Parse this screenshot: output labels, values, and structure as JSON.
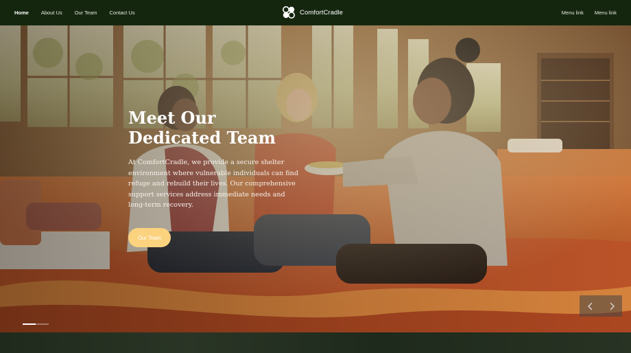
{
  "nav": {
    "left_links": [
      {
        "label": "Home",
        "active": true
      },
      {
        "label": "About Us",
        "active": false
      },
      {
        "label": "Our Team",
        "active": false
      },
      {
        "label": "Contact Us",
        "active": false
      }
    ],
    "brand": "ComfortCradle",
    "right_links": [
      "Menu link",
      "Menu link"
    ]
  },
  "hero": {
    "title": "Meet Our Dedicated Team",
    "text": "At ComfortCradle, we provide a secure shelter environment where vulnerable individuals can find refuge and rebuild their lives. Our comprehensive support services address immediate needs and long-term recovery.",
    "button_label": "Our Team"
  },
  "carousel": {
    "prev_icon": "chevron-left-icon",
    "next_icon": "chevron-right-icon"
  },
  "colors": {
    "nav_bg": "#15260f",
    "button": "#fbd27e"
  }
}
